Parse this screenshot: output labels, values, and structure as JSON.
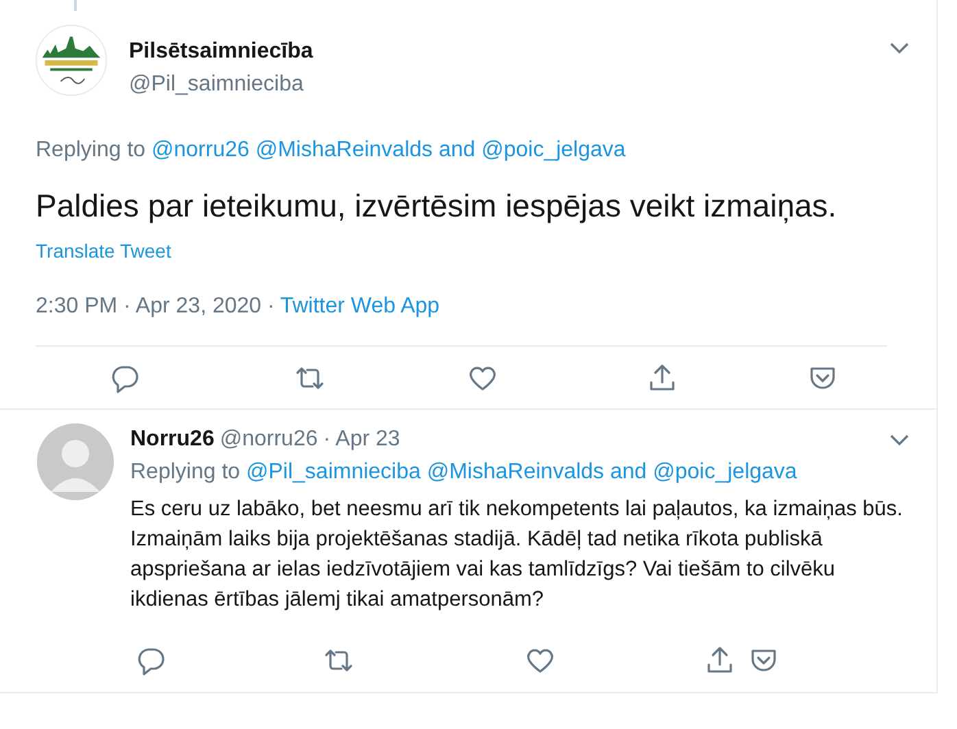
{
  "main_tweet": {
    "name": "Pilsētsaimniecība",
    "handle": "@Pil_saimnieciba",
    "replying": {
      "prefix": "Replying to",
      "links": [
        "@norru26",
        "@MishaReinvalds and @poic_jelgava"
      ]
    },
    "text": "Paldies par ieteikumu, izvērtēsim iespējas veikt izmaiņas.",
    "translate": "Translate Tweet",
    "timestamp": "2:30 PM · Apr 23, 2020 ·",
    "source": "Twitter Web App"
  },
  "reply_tweet": {
    "name": "Norru26",
    "handle": "@norru26",
    "date": "· Apr 23",
    "replying": {
      "prefix": "Replying to",
      "links": [
        "@Pil_saimnieciba",
        "@MishaReinvalds and @poic_jelgava"
      ]
    },
    "text": "Es ceru uz labāko, bet neesmu arī tik nekompetents lai paļautos, ka izmaiņas būs. Izmaiņām laiks bija projektēšanas stadijā. Kādēļ tad netika rīkota publiskā apspriešana ar ielas iedzīvotājiem vai kas tamlīdzīgs? Vai tiešām to cilvēku ikdienas ērtības jālemj tikai amatpersonām?"
  }
}
